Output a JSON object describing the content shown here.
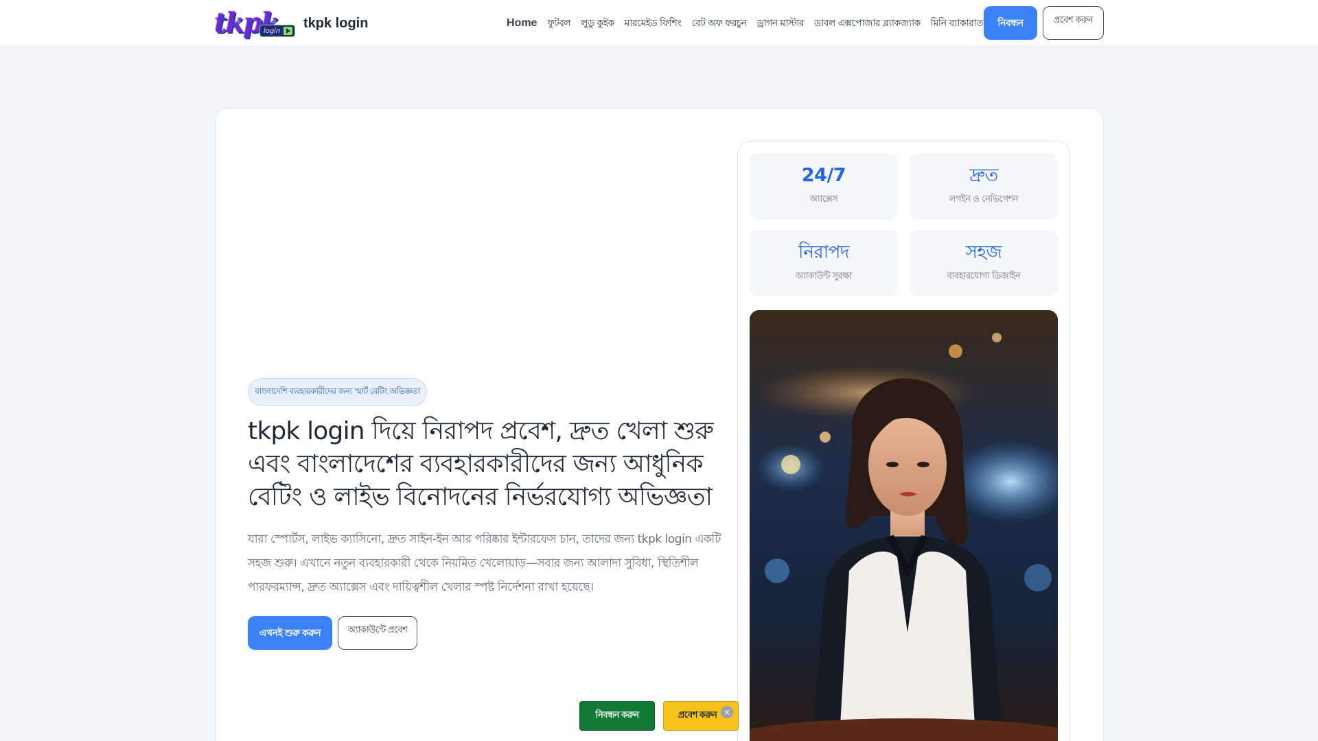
{
  "header": {
    "logo_text": "tkpk",
    "logo_sub": "login",
    "brand_name": "tkpk login",
    "nav": [
      "Home",
      "ফুটবল",
      "লুডু কুইক",
      "মারমেইড ফিশিং",
      "বেট অফ ফরচুন",
      "ড্রাগন মাস্টার",
      "ডাবল এক্সপোজার ব্ল্যাকজ্যাক",
      "মিনি ব্যাকারাত"
    ],
    "register_label": "নিবন্ধন",
    "login_label": "প্রবেশ করুন"
  },
  "hero": {
    "tag": "বাংলাদেশি ব্যবহারকারীদের জন্য স্মার্ট বেটিং অভিজ্ঞতা",
    "title": "tkpk login দিয়ে নিরাপদ প্রবেশ, দ্রুত খেলা শুরু এবং বাংলাদেশের ব্যবহারকারীদের জন্য আধুনিক বেটিং ও লাইভ বিনোদনের নির্ভরযোগ্য অভিজ্ঞতা",
    "description": "যারা স্পোর্টস, লাইভ ক্যাসিনো, দ্রুত সাইন-ইন আর পরিষ্কার ইন্টারফেস চান, তাদের জন্য tkpk login একটি সহজ শুরু। এখানে নতুন ব্যবহারকারী থেকে নিয়মিত খেলোয়াড়—সবার জন্য আলাদা সুবিধা, স্থিতিশীল পারফরম্যান্স, দ্রুত অ্যাক্সেস এবং দায়িত্বশীল খেলার স্পষ্ট নির্দেশনা রাখা হয়েছে।",
    "start_label": "এখনই শুরু করুন",
    "account_label": "অ্যাকাউন্টে প্রবেশ"
  },
  "stats": [
    {
      "value": "24/7",
      "label": "অ্যাক্সেস"
    },
    {
      "value": "দ্রুত",
      "label": "লগইন ও নেভিগেশন"
    },
    {
      "value": "নিরাপদ",
      "label": "অ্যাকাউন্ট সুরক্ষা"
    },
    {
      "value": "সহজ",
      "label": "ব্যবহারযোগ্য ডিজাইন"
    }
  ],
  "sticky": {
    "register_label": "নিবন্ধন করুন",
    "login_label": "প্রবেশ করুন",
    "close_symbol": "×"
  },
  "colors": {
    "accent": "#3b82f6",
    "register_green": "#0f7a34",
    "login_yellow": "#f6c21b"
  }
}
